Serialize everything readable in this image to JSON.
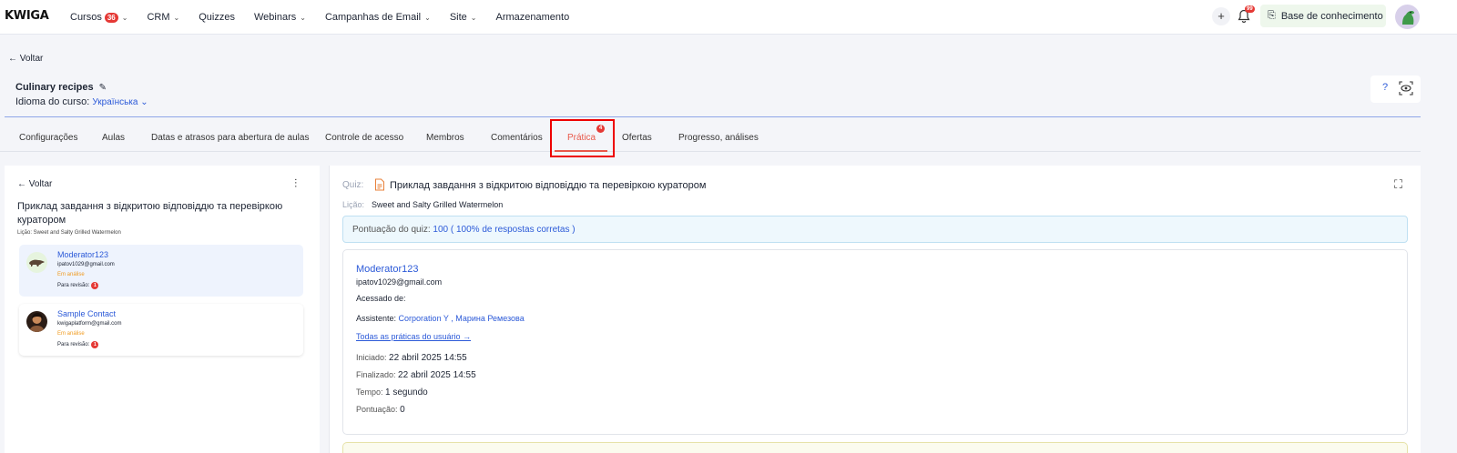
{
  "app": {
    "logo": "KWIGA"
  },
  "nav": {
    "items": [
      {
        "label": "Cursos",
        "badge": "36",
        "dropdown": true
      },
      {
        "label": "CRM",
        "dropdown": true
      },
      {
        "label": "Quizzes",
        "dropdown": false
      },
      {
        "label": "Webinars",
        "dropdown": true
      },
      {
        "label": "Campanhas de Email",
        "dropdown": true
      },
      {
        "label": "Site",
        "dropdown": true
      },
      {
        "label": "Armazenamento",
        "dropdown": false
      }
    ],
    "plus": "+",
    "notifications_badge": "99",
    "knowledge_base": "Base de conhecimento"
  },
  "header": {
    "back": "Voltar",
    "course_title": "Culinary recipes",
    "lang_label": "Idioma do curso:",
    "lang_value": "Українська",
    "help": "?"
  },
  "tabs": {
    "items": [
      "Configurações",
      "Aulas",
      "Datas e atrasos para abertura de aulas",
      "Controle de acesso",
      "Membros",
      "Comentários",
      "Prática",
      "Ofertas",
      "Progresso, análises"
    ],
    "active": "Prática",
    "active_badge": "4"
  },
  "left": {
    "back": "Voltar",
    "title": "Приклад завдання з відкритою відповіддю та перевіркою куратором",
    "lesson": "Lição: Sweet and Salty Grilled Watermelon",
    "submissions": [
      {
        "name": "Moderator123",
        "email": "ipatov1029@gmail.com",
        "status": "Em análise",
        "review_label": "Para revisão:",
        "review_count": "1"
      },
      {
        "name": "Sample Contact",
        "email": "kwigaplatform@gmail.com",
        "status": "Em análise",
        "review_label": "Para revisão:",
        "review_count": "1"
      }
    ]
  },
  "right": {
    "quiz_label": "Quiz:",
    "quiz_title": "Приклад завдання з відкритою відповіддю та перевіркою куратором",
    "lesson_label": "Lição:",
    "lesson_value": "Sweet and Salty Grilled Watermelon",
    "score_label": "Pontuação do quiz:",
    "score_value": "100 ( 100% de respostas corretas )",
    "user_name": "Moderator123",
    "user_email": "ipatov1029@gmail.com",
    "accessed_label": "Acessado de:",
    "assistant_label": "Assistente:",
    "assistant_1": "Corporation Y",
    "assistant_sep": " , ",
    "assistant_2": "Марина Ремезова",
    "all_practices": "Todas as práticas do usuário →",
    "started_label": "Iniciado:",
    "started_value": "22 abril 2025 14:55",
    "finished_label": "Finalizado:",
    "finished_value": "22 abril 2025 14:55",
    "time_label": "Tempo:",
    "time_value": "1 segundo",
    "score2_label": "Pontuação:",
    "score2_value": "0"
  },
  "colors": {
    "accent": "#2c5ad8",
    "active_tab": "#e8584a",
    "badge": "#e53935",
    "status": "#f09a1e"
  }
}
